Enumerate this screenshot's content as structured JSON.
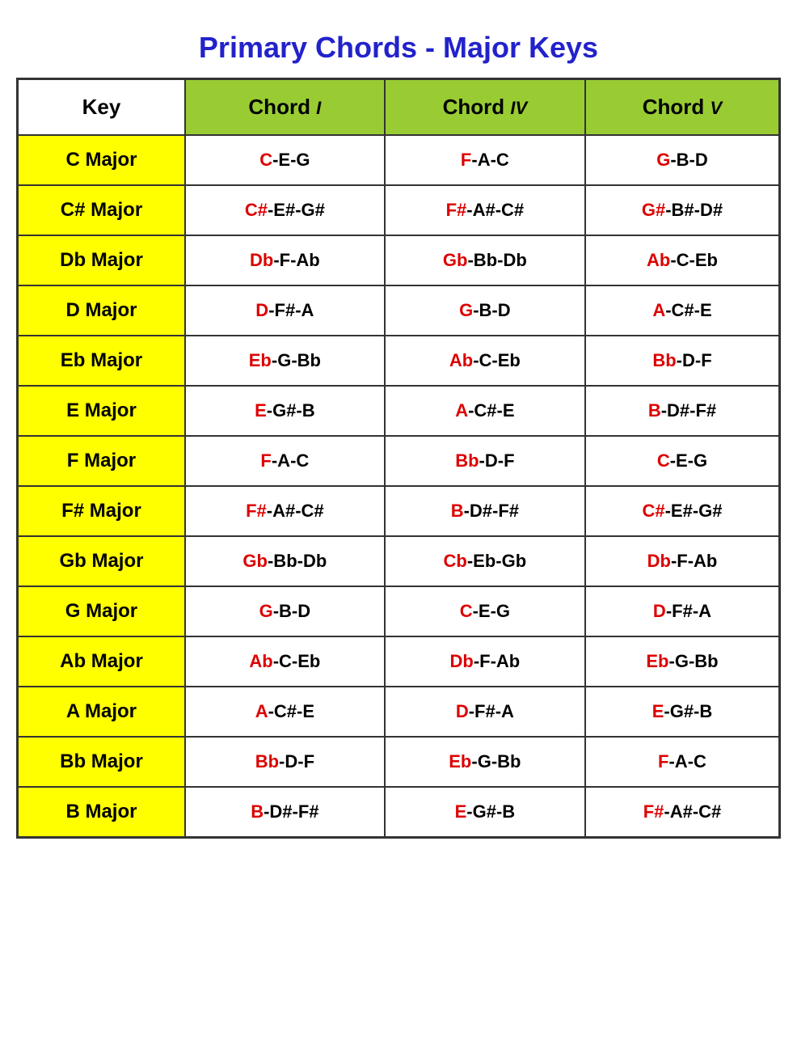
{
  "title": "Primary Chords - Major Keys",
  "headers": {
    "key": "Key",
    "chord1": {
      "prefix": "Chord ",
      "roman": "I"
    },
    "chord4": {
      "prefix": "Chord ",
      "roman": "IV"
    },
    "chord5": {
      "prefix": "Chord ",
      "roman": "V"
    }
  },
  "rows": [
    {
      "key": "C Major",
      "chord1": {
        "red": "C",
        "black": "-E-G"
      },
      "chord4": {
        "red": "F",
        "black": "-A-C"
      },
      "chord5": {
        "red": "G",
        "black": "-B-D"
      }
    },
    {
      "key": "C# Major",
      "chord1": {
        "red": "C#",
        "black": "-E#-G#"
      },
      "chord4": {
        "red": "F#",
        "black": "-A#-C#"
      },
      "chord5": {
        "red": "G#",
        "black": "-B#-D#"
      }
    },
    {
      "key": "Db Major",
      "chord1": {
        "red": "Db",
        "black": "-F-Ab"
      },
      "chord4": {
        "red": "Gb",
        "black": "-Bb-Db"
      },
      "chord5": {
        "red": "Ab",
        "black": "-C-Eb"
      }
    },
    {
      "key": "D Major",
      "chord1": {
        "red": "D",
        "black": "-F#-A"
      },
      "chord4": {
        "red": "G",
        "black": "-B-D"
      },
      "chord5": {
        "red": "A",
        "black": "-C#-E"
      }
    },
    {
      "key": "Eb Major",
      "chord1": {
        "red": "Eb",
        "black": "-G-Bb"
      },
      "chord4": {
        "red": "Ab",
        "black": "-C-Eb"
      },
      "chord5": {
        "red": "Bb",
        "black": "-D-F"
      }
    },
    {
      "key": "E Major",
      "chord1": {
        "red": "E",
        "black": "-G#-B"
      },
      "chord4": {
        "red": "A",
        "black": "-C#-E"
      },
      "chord5": {
        "red": "B",
        "black": "-D#-F#"
      }
    },
    {
      "key": "F Major",
      "chord1": {
        "red": "F",
        "black": "-A-C"
      },
      "chord4": {
        "red": "Bb",
        "black": "-D-F"
      },
      "chord5": {
        "red": "C",
        "black": "-E-G"
      }
    },
    {
      "key": "F# Major",
      "chord1": {
        "red": "F#",
        "black": "-A#-C#"
      },
      "chord4": {
        "red": "B",
        "black": "-D#-F#"
      },
      "chord5": {
        "red": "C#",
        "black": "-E#-G#"
      }
    },
    {
      "key": "Gb Major",
      "chord1": {
        "red": "Gb",
        "black": "-Bb-Db"
      },
      "chord4": {
        "red": "Cb",
        "black": "-Eb-Gb"
      },
      "chord5": {
        "red": "Db",
        "black": "-F-Ab"
      }
    },
    {
      "key": "G Major",
      "chord1": {
        "red": "G",
        "black": "-B-D"
      },
      "chord4": {
        "red": "C",
        "black": "-E-G"
      },
      "chord5": {
        "red": "D",
        "black": "-F#-A"
      }
    },
    {
      "key": "Ab Major",
      "chord1": {
        "red": "Ab",
        "black": "-C-Eb"
      },
      "chord4": {
        "red": "Db",
        "black": "-F-Ab"
      },
      "chord5": {
        "red": "Eb",
        "black": "-G-Bb"
      }
    },
    {
      "key": "A Major",
      "chord1": {
        "red": "A",
        "black": "-C#-E"
      },
      "chord4": {
        "red": "D",
        "black": "-F#-A"
      },
      "chord5": {
        "red": "E",
        "black": "-G#-B"
      }
    },
    {
      "key": "Bb Major",
      "chord1": {
        "red": "Bb",
        "black": "-D-F"
      },
      "chord4": {
        "red": "Eb",
        "black": "-G-Bb"
      },
      "chord5": {
        "red": "F",
        "black": "-A-C"
      }
    },
    {
      "key": "B Major",
      "chord1": {
        "red": "B",
        "black": "-D#-F#"
      },
      "chord4": {
        "red": "E",
        "black": "-G#-B"
      },
      "chord5": {
        "red": "F#",
        "black": "-A#-C#"
      }
    }
  ]
}
